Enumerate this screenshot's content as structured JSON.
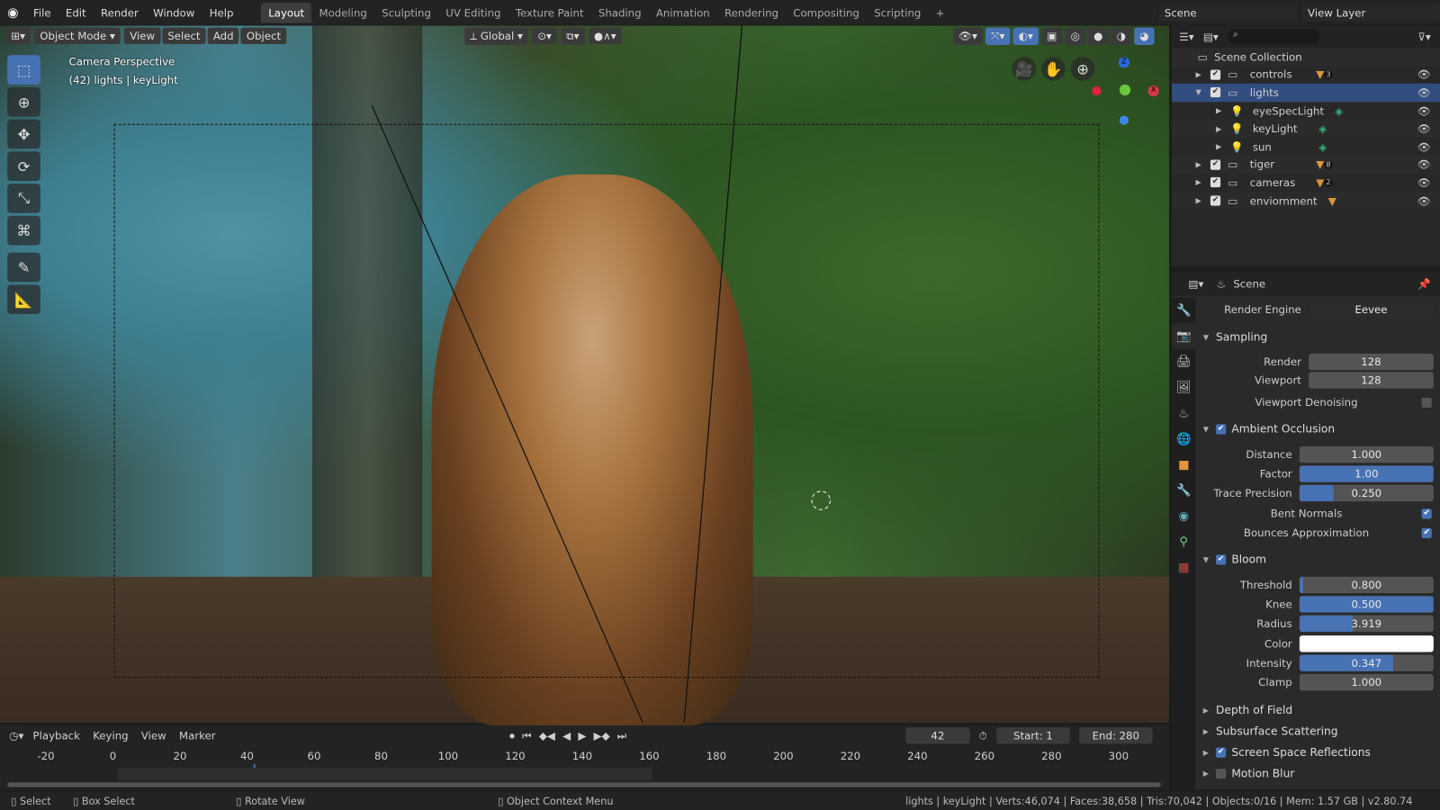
{
  "app": {
    "menus": [
      "File",
      "Edit",
      "Render",
      "Window",
      "Help"
    ],
    "workspaces": [
      "Layout",
      "Modeling",
      "Sculpting",
      "UV Editing",
      "Texture Paint",
      "Shading",
      "Animation",
      "Rendering",
      "Compositing",
      "Scripting"
    ],
    "active_workspace": "Layout",
    "scene": "Scene",
    "view_layer": "View Layer"
  },
  "viewport": {
    "mode": "Object Mode",
    "menus": [
      "View",
      "Select",
      "Add",
      "Object"
    ],
    "transform_orientation": "Global",
    "overlay_title": "Camera Perspective",
    "overlay_sub": "(42) lights | keyLight",
    "tools": [
      "select-box",
      "cursor",
      "move",
      "rotate",
      "scale",
      "transform",
      "annotate",
      "measure"
    ],
    "gizmo": {
      "z": "Z",
      "x": "X"
    }
  },
  "outliner": {
    "root": "Scene Collection",
    "items": [
      {
        "name": "controls",
        "level": 0,
        "expanded": false,
        "checked": true,
        "badge": "3",
        "icon": "collection",
        "extra_color": "#e0953a"
      },
      {
        "name": "lights",
        "level": 0,
        "expanded": true,
        "checked": true,
        "selected": true,
        "icon": "collection"
      },
      {
        "name": "eyeSpecLight",
        "level": 1,
        "icon": "light",
        "extra_color": "#35b07c"
      },
      {
        "name": "keyLight",
        "level": 1,
        "icon": "light",
        "extra_color": "#35b07c"
      },
      {
        "name": "sun",
        "level": 1,
        "icon": "light",
        "extra_color": "#35b07c"
      },
      {
        "name": "tiger",
        "level": 0,
        "checked": true,
        "badge": "8",
        "icon": "collection",
        "extra_color": "#e0953a"
      },
      {
        "name": "cameras",
        "level": 0,
        "checked": true,
        "badge": "2",
        "icon": "collection",
        "extra_color": "#e0953a"
      },
      {
        "name": "enviornment",
        "level": 0,
        "checked": true,
        "icon": "collection",
        "extra_color": "#e0953a"
      }
    ]
  },
  "properties": {
    "context": "Scene",
    "render_engine_label": "Render Engine",
    "render_engine": "Eevee",
    "sampling": {
      "title": "Sampling",
      "render_label": "Render",
      "render": "128",
      "viewport_label": "Viewport",
      "viewport": "128",
      "denoise_label": "Viewport Denoising",
      "denoise": false
    },
    "ao": {
      "title": "Ambient Occlusion",
      "enabled": true,
      "distance_label": "Distance",
      "distance": "1.000",
      "factor_label": "Factor",
      "factor": "1.00",
      "factor_fill": 100,
      "trace_label": "Trace Precision",
      "trace": "0.250",
      "trace_fill": 25,
      "bent_label": "Bent Normals",
      "bent": true,
      "bounces_label": "Bounces Approximation",
      "bounces": true
    },
    "bloom": {
      "title": "Bloom",
      "enabled": true,
      "threshold_label": "Threshold",
      "threshold": "0.800",
      "threshold_fill": 3,
      "knee_label": "Knee",
      "knee": "0.500",
      "knee_fill": 100,
      "radius_label": "Radius",
      "radius": "3.919",
      "radius_fill": 40,
      "color_label": "Color",
      "color": "#ffffff",
      "intensity_label": "Intensity",
      "intensity": "0.347",
      "intensity_fill": 70,
      "clamp_label": "Clamp",
      "clamp": "1.000"
    },
    "collapsed": [
      {
        "title": "Depth of Field"
      },
      {
        "title": "Subsurface Scattering"
      },
      {
        "title": "Screen Space Reflections",
        "checkbox": true
      },
      {
        "title": "Motion Blur",
        "checkbox": false
      }
    ]
  },
  "timeline": {
    "menus": [
      "Playback",
      "Keying",
      "View",
      "Marker"
    ],
    "current_frame": "42",
    "start_label": "Start:",
    "start": "1",
    "end_label": "End:",
    "end": "280",
    "ticks": [
      "-20",
      "0",
      "20",
      "40",
      "60",
      "80",
      "100",
      "120",
      "140",
      "160",
      "180",
      "200",
      "220",
      "240",
      "260",
      "280",
      "300"
    ]
  },
  "status": {
    "select": "Select",
    "box_select": "Box Select",
    "rotate": "Rotate View",
    "context_menu": "Object Context Menu",
    "stats": "lights | keyLight | Verts:46,074 | Faces:38,658 | Tris:70,042 | Objects:0/16 | Mem: 1.57 GB | v2.80.74"
  },
  "colors": {
    "accent": "#4772b3",
    "selected_row": "#334d80",
    "light_icon": "#e0953a"
  }
}
